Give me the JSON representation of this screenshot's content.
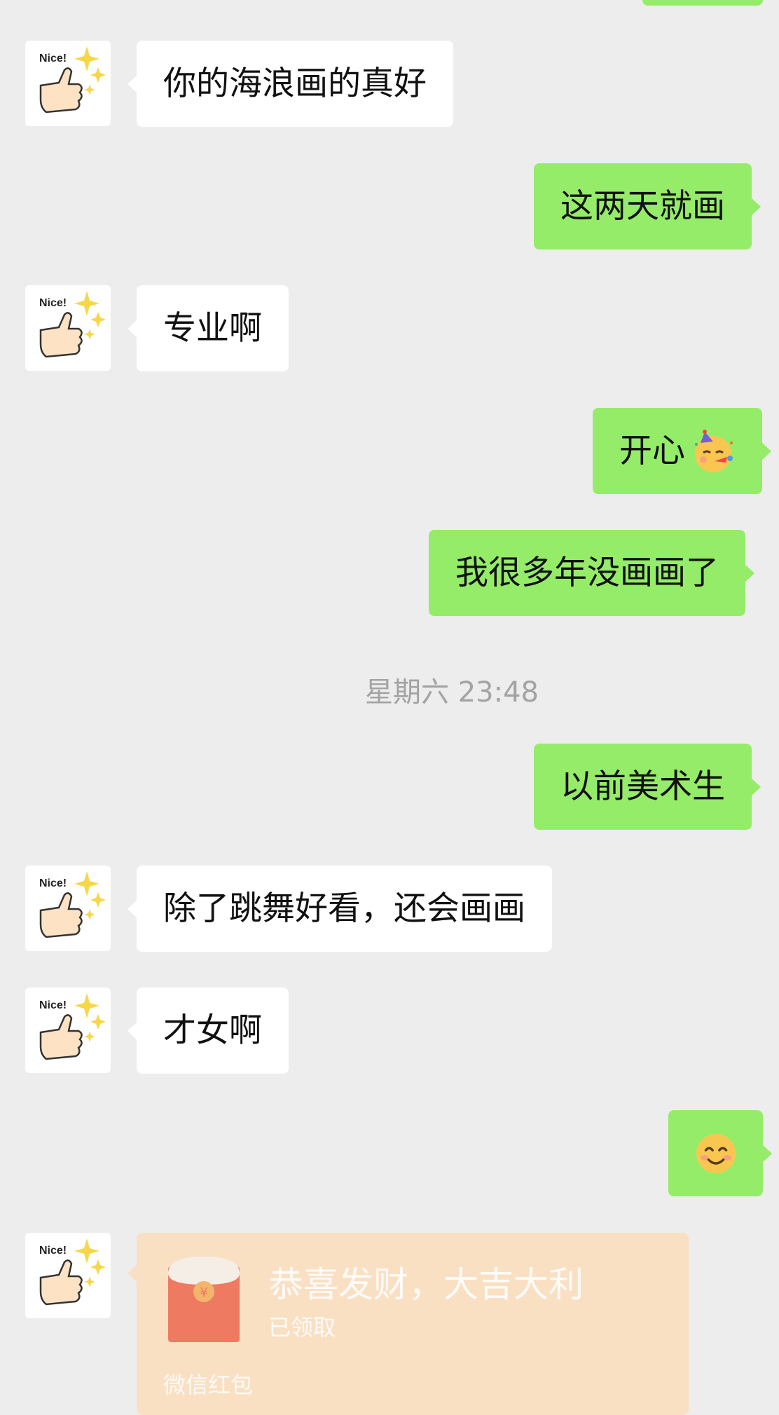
{
  "messages": [
    {
      "id": "m1",
      "side": "in",
      "text": "你的海浪画的真好"
    },
    {
      "id": "m2",
      "side": "out",
      "text": "这两天就画"
    },
    {
      "id": "m3",
      "side": "in",
      "text": "专业啊"
    },
    {
      "id": "m4",
      "side": "out",
      "text": "开心"
    },
    {
      "id": "m5",
      "side": "out",
      "text": "我很多年没画画了"
    },
    {
      "id": "m6",
      "side": "out",
      "text": "以前美术生"
    },
    {
      "id": "m7",
      "side": "in",
      "text": "除了跳舞好看，还会画画"
    },
    {
      "id": "m8",
      "side": "in",
      "text": "才女啊"
    },
    {
      "id": "m9",
      "side": "out",
      "text": ""
    }
  ],
  "timestamp": "星期六 23:48",
  "avatar_text": "Nice!",
  "red_packet": {
    "title": "恭喜发财，大吉大利",
    "status": "已领取",
    "footer": "微信红包"
  },
  "icons": {
    "avatar": "thumbs-up-sticker-icon",
    "party": "party-face-emoji-icon",
    "smile": "smiling-face-emoji-icon",
    "red_packet": "red-envelope-icon"
  },
  "colors": {
    "background": "#ededed",
    "incoming_bubble": "#ffffff",
    "outgoing_bubble": "#95ec69",
    "red_packet_bg": "#fae0c3",
    "red_envelope": "#ee7a62"
  }
}
